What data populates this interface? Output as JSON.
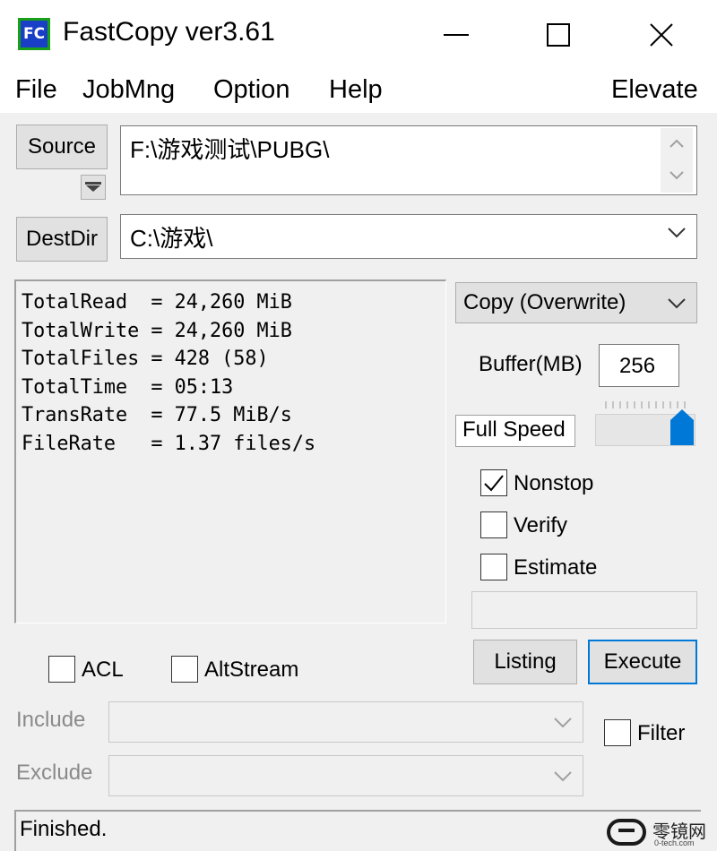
{
  "window": {
    "title": "FastCopy ver3.61",
    "icon_text": "FC",
    "controls": [
      "minimize-icon",
      "maximize-icon",
      "close-icon"
    ]
  },
  "menu": {
    "items": [
      "File",
      "JobMng",
      "Option",
      "Help"
    ],
    "elevate": "Elevate"
  },
  "source": {
    "button_label": "Source",
    "path": "F:\\游戏测试\\PUBG\\"
  },
  "destdir": {
    "button_label": "DestDir",
    "path": "C:\\游戏\\"
  },
  "stats": {
    "lines": [
      "TotalRead  = 24,260 MiB",
      "TotalWrite = 24,260 MiB",
      "TotalFiles = 428 (58)",
      "TotalTime  = 05:13",
      "TransRate  = 77.5 MiB/s",
      "FileRate   = 1.37 files/s"
    ]
  },
  "options": {
    "mode": "Copy (Overwrite)",
    "buffer_label": "Buffer(MB)",
    "buffer_value": "256",
    "speed_label": "Full Speed",
    "speed_level": 1.0,
    "nonstop": {
      "label": "Nonstop",
      "checked": true
    },
    "verify": {
      "label": "Verify",
      "checked": false
    },
    "estimate": {
      "label": "Estimate",
      "checked": false
    }
  },
  "actions": {
    "listing": "Listing",
    "execute": "Execute"
  },
  "flags": {
    "acl": {
      "label": "ACL",
      "checked": false
    },
    "altstream": {
      "label": "AltStream",
      "checked": false
    },
    "filter": {
      "label": "Filter",
      "checked": false
    }
  },
  "filters": {
    "include_label": "Include",
    "exclude_label": "Exclude"
  },
  "status": {
    "text": "Finished."
  },
  "watermark": {
    "name": "零镜网",
    "domain": "0-tech.com",
    "colors": {
      "icon": "#1a1a1a"
    }
  },
  "colors": {
    "accent": "#0078d7",
    "execute_border": "#0078d7",
    "app_icon_bg": "#1a3fc7",
    "app_icon_border": "#18a018"
  }
}
